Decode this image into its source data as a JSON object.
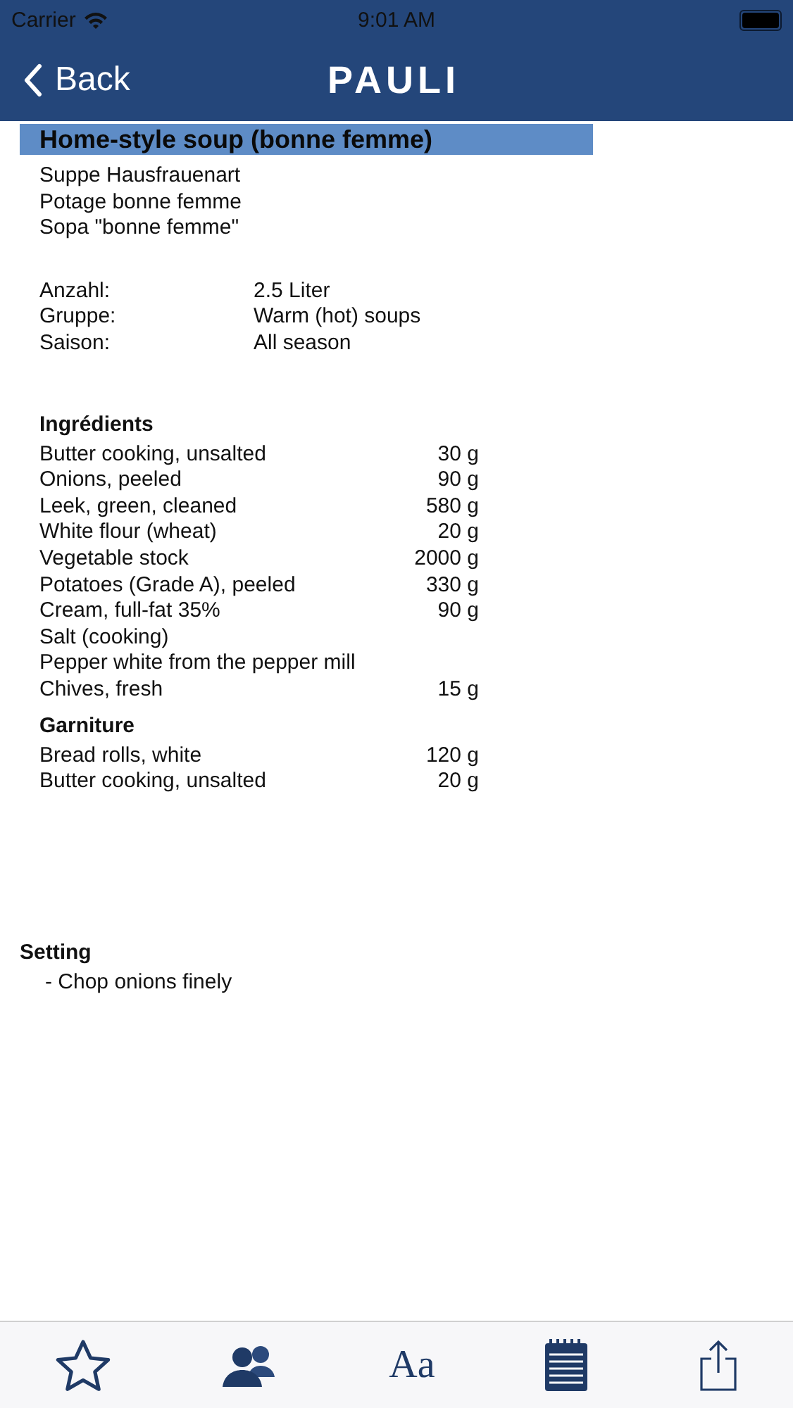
{
  "status_bar": {
    "carrier": "Carrier",
    "time": "9:01 AM"
  },
  "nav": {
    "back": "Back",
    "logo": "PAULI"
  },
  "recipe": {
    "title": "Home-style soup (bonne femme)",
    "translations": [
      "Suppe Hausfrauenart",
      "Potage bonne femme",
      "Sopa \"bonne femme\""
    ],
    "facts": [
      {
        "label": "Anzahl:",
        "value": "2.5 Liter"
      },
      {
        "label": "Gruppe:",
        "value": "Warm (hot) soups"
      },
      {
        "label": "Saison:",
        "value": "All season"
      }
    ],
    "sections": [
      {
        "heading": "Ingrédients",
        "items": [
          {
            "name": "Butter cooking, unsalted",
            "qty": "30 g"
          },
          {
            "name": "Onions, peeled",
            "qty": "90 g"
          },
          {
            "name": "Leek, green, cleaned",
            "qty": "580 g"
          },
          {
            "name": "White flour (wheat)",
            "qty": "20 g"
          },
          {
            "name": "Vegetable stock",
            "qty": "2000 g"
          },
          {
            "name": "Potatoes (Grade A), peeled",
            "qty": "330 g"
          },
          {
            "name": "Cream, full-fat 35%",
            "qty": "90 g"
          },
          {
            "name": "Salt (cooking)"
          },
          {
            "name": "Pepper white from the pepper mill"
          },
          {
            "name": "Chives, fresh",
            "qty": "15 g"
          }
        ]
      },
      {
        "heading": "Garniture",
        "items": [
          {
            "name": "Bread rolls, white",
            "qty": "120 g"
          },
          {
            "name": "Butter cooking, unsalted",
            "qty": "20 g"
          }
        ]
      }
    ],
    "method": {
      "heading": "Setting",
      "steps": [
        "- Chop onions finely"
      ]
    }
  },
  "tab_bar": [
    {
      "kind": "star"
    },
    {
      "kind": "people"
    },
    {
      "kind": "font",
      "label": "Aa"
    },
    {
      "kind": "notes"
    },
    {
      "kind": "share"
    }
  ]
}
